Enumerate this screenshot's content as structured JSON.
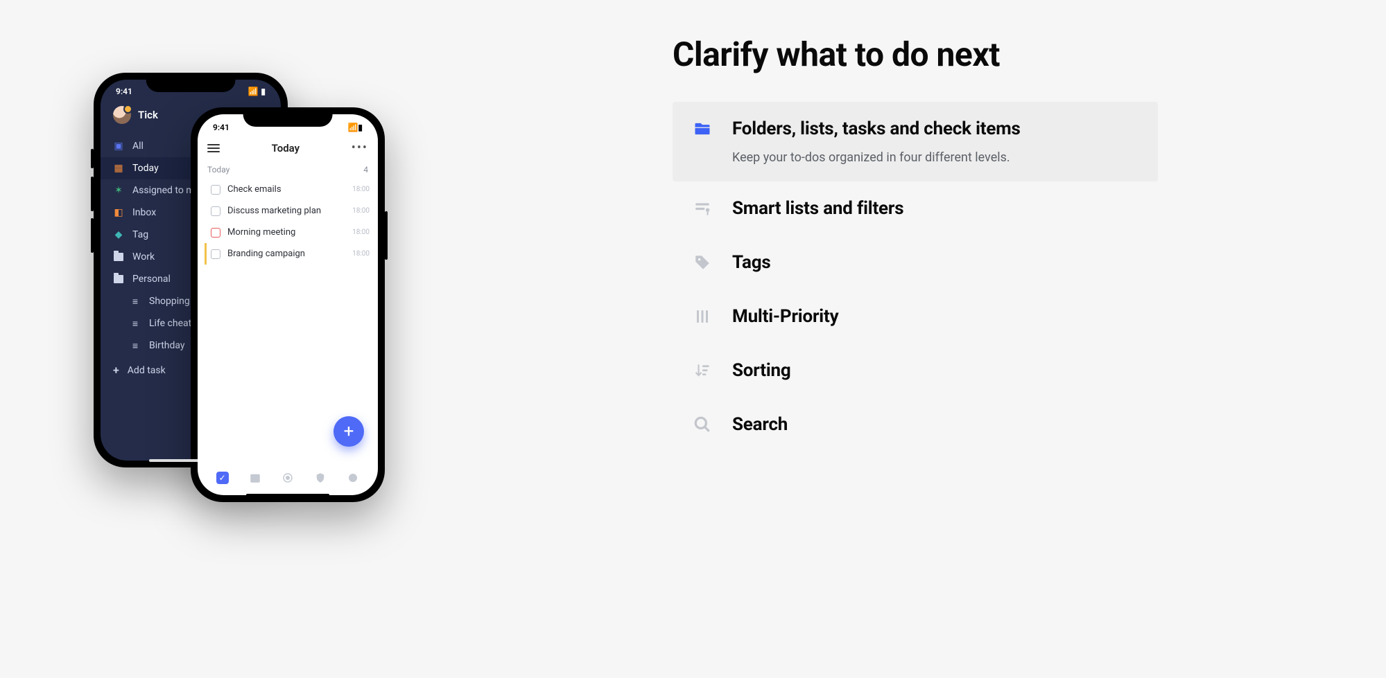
{
  "headline": "Clarify what to do next",
  "features": [
    {
      "title": "Folders, lists, tasks and check items",
      "desc": "Keep your to-dos organized in four different levels.",
      "icon": "folder-icon"
    },
    {
      "title": "Smart lists and filters",
      "icon": "filter-icon"
    },
    {
      "title": "Tags",
      "icon": "tag-icon"
    },
    {
      "title": "Multi-Priority",
      "icon": "priority-icon"
    },
    {
      "title": "Sorting",
      "icon": "sort-icon"
    },
    {
      "title": "Search",
      "icon": "search-icon"
    }
  ],
  "phone_back": {
    "status_time": "9:41",
    "app_name": "Tick",
    "items": [
      {
        "label": "All",
        "icon": "all",
        "color": "#5a74f2"
      },
      {
        "label": "Today",
        "icon": "today",
        "color": "#f08b3c",
        "active": true
      },
      {
        "label": "Assigned to me",
        "icon": "assigned",
        "color": "#3fb67a"
      },
      {
        "label": "Inbox",
        "icon": "inbox",
        "color": "#f08b3c"
      },
      {
        "label": "Tag",
        "icon": "tag",
        "color": "#3fb6b6"
      },
      {
        "label": "Work",
        "icon": "folder",
        "color": "#cfd6ea"
      },
      {
        "label": "Personal",
        "icon": "folder-open",
        "color": "#cfd6ea"
      }
    ],
    "sub_items": [
      {
        "label": "Shopping"
      },
      {
        "label": "Life cheat"
      },
      {
        "label": "Birthday"
      }
    ],
    "add_task": "Add task"
  },
  "phone_front": {
    "status_time": "9:41",
    "title": "Today",
    "section_label": "Today",
    "section_count": "4",
    "tasks": [
      {
        "label": "Check emails",
        "time": "18:00"
      },
      {
        "label": "Discuss marketing plan",
        "time": "18:00"
      },
      {
        "label": "Morning meeting",
        "time": "18:00",
        "variant": "red"
      },
      {
        "label": "Branding campaign",
        "time": "18:00",
        "variant": "yellow"
      }
    ]
  }
}
